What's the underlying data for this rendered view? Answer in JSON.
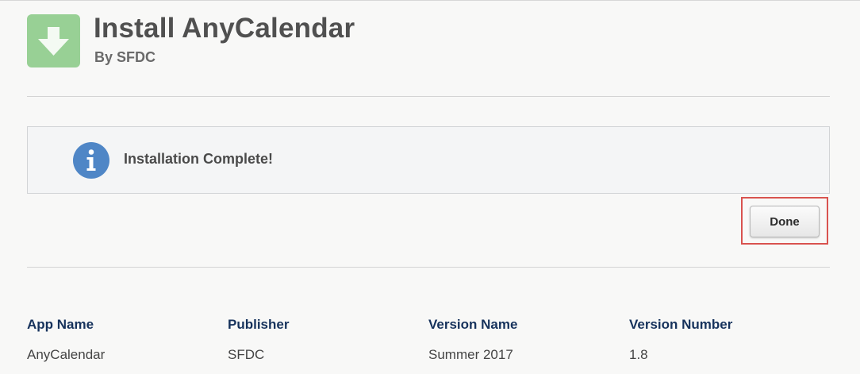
{
  "header": {
    "logo_icon": "download-arrow-icon",
    "title": "Install AnyCalendar",
    "subtitle": "By SFDC"
  },
  "notice": {
    "icon": "info-icon",
    "message": "Installation Complete!"
  },
  "actions": {
    "done_label": "Done"
  },
  "details": {
    "headers": [
      "App Name",
      "Publisher",
      "Version Name",
      "Version Number"
    ],
    "values": [
      "AnyCalendar",
      "SFDC",
      "Summer 2017",
      "1.8"
    ]
  },
  "colors": {
    "logo_bg": "#98d095",
    "info_icon": "#4f86c6",
    "highlight_border": "#d9534f",
    "header_text": "#16325c"
  }
}
